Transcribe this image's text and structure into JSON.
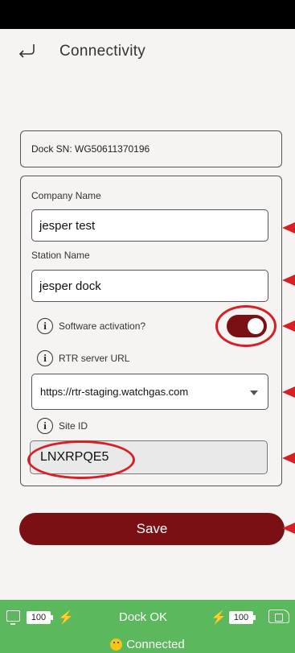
{
  "header": {
    "title": "Connectivity"
  },
  "dock": {
    "sn_label": "Dock SN: WG50611370196"
  },
  "form": {
    "company_label": "Company Name",
    "company_value": "jesper test",
    "station_label": "Station Name",
    "station_value": "jesper dock",
    "software_label": "Software activation?",
    "software_enabled": true,
    "rtr_label": "RTR server URL",
    "rtr_value": "https://rtr-staging.watchgas.com",
    "site_label": "Site ID",
    "site_value": "LNXRPQE5",
    "info_glyph": "i"
  },
  "actions": {
    "save_label": "Save"
  },
  "footer": {
    "left_battery": "100",
    "right_battery": "100",
    "dock_status": "Dock OK",
    "connection": "Connected",
    "bolt_glyph": "⚡"
  },
  "colors": {
    "brand": "#7a0f14",
    "annotation_red": "#d81f26",
    "status_green": "#5cb85c",
    "background": "#f5f4f2"
  },
  "icons": [
    "back-arrow-icon",
    "info-icon",
    "chevron-down-icon",
    "monitor-icon",
    "bolt-icon",
    "battery-icon",
    "dock-icon",
    "smiley-icon"
  ]
}
